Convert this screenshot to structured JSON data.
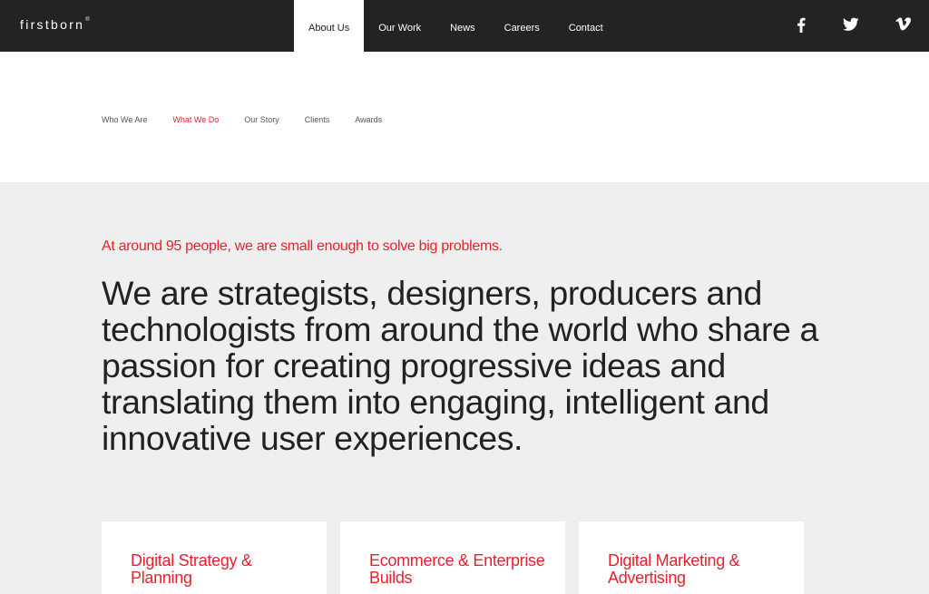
{
  "header": {
    "logo": "firstborn",
    "logo_mark": "®",
    "nav": [
      {
        "label": "About Us",
        "active": true
      },
      {
        "label": "Our Work",
        "active": false
      },
      {
        "label": "News",
        "active": false
      },
      {
        "label": "Careers",
        "active": false
      },
      {
        "label": "Contact",
        "active": false
      }
    ],
    "social_icons": [
      "facebook-icon",
      "twitter-icon",
      "vimeo-icon"
    ]
  },
  "subnav": {
    "items": [
      {
        "label": "Who We Are",
        "active": false
      },
      {
        "label": "What We Do",
        "active": true
      },
      {
        "label": "Our Story",
        "active": false
      },
      {
        "label": "Clients",
        "active": false
      },
      {
        "label": "Awards",
        "active": false
      }
    ]
  },
  "main": {
    "tagline": "At around 95 people, we are small enough to solve big problems.",
    "headline": "We are strategists, designers, producers and technologists from around the world who share a passion for creating progressive ideas and translating them into engaging, intelligent and innovative user experiences.",
    "cards": [
      {
        "title": "Digital Strategy & Planning"
      },
      {
        "title": "Ecommerce & Enterprise Builds"
      },
      {
        "title": "Digital Marketing & Advertising"
      }
    ]
  },
  "colors": {
    "accent": "#e8212c",
    "topbar": "#232323",
    "background": "#efefef",
    "text": "#222222"
  }
}
